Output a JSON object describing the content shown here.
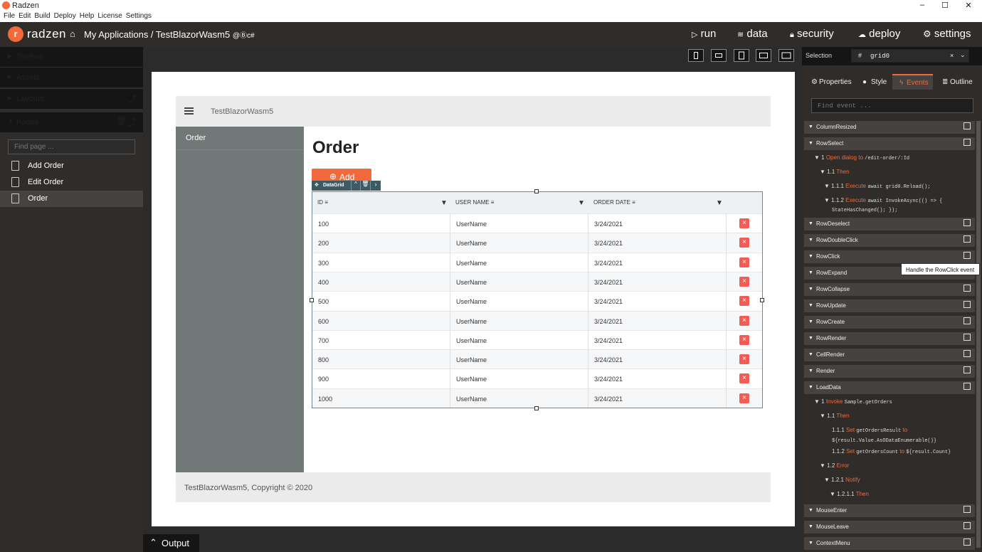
{
  "window": {
    "title": "Radzen",
    "controls": [
      "–",
      "☐",
      "✕"
    ]
  },
  "menubar": [
    "File",
    "Edit",
    "Build",
    "Deploy",
    "Help",
    "License",
    "Settings"
  ],
  "appbar": {
    "brand": "radzen",
    "breadcrumb": "My Applications / TestBlazorWasm5",
    "badges": "@Ⓑc#",
    "nav": [
      {
        "icon": "play-icon",
        "label": "run"
      },
      {
        "icon": "database-icon",
        "label": "data"
      },
      {
        "icon": "lock-icon",
        "label": "security"
      },
      {
        "icon": "cloud-icon",
        "label": "deploy"
      },
      {
        "icon": "gear-icon",
        "label": "settings"
      }
    ]
  },
  "sidebar": {
    "sections": [
      "Toolbox",
      "Assets",
      "Layouts",
      "Pages"
    ],
    "find_placeholder": "Find page ...",
    "pages": [
      "Add Order",
      "Edit Order",
      "Order"
    ],
    "selected_page": "Order"
  },
  "output_tab": "Output",
  "preview": {
    "app_name": "TestBlazorWasm5",
    "side_menu_item": "Order",
    "heading": "Order",
    "add_button": "Add",
    "datagrid_tag": "DataGrid",
    "columns": [
      "ID",
      "USER NAME",
      "ORDER DATE"
    ],
    "rows": [
      [
        "100",
        "UserName",
        "3/24/2021"
      ],
      [
        "200",
        "UserName",
        "3/24/2021"
      ],
      [
        "300",
        "UserName",
        "3/24/2021"
      ],
      [
        "400",
        "UserName",
        "3/24/2021"
      ],
      [
        "500",
        "UserName",
        "3/24/2021"
      ],
      [
        "600",
        "UserName",
        "3/24/2021"
      ],
      [
        "700",
        "UserName",
        "3/24/2021"
      ],
      [
        "800",
        "UserName",
        "3/24/2021"
      ],
      [
        "900",
        "UserName",
        "3/24/2021"
      ],
      [
        "1000",
        "UserName",
        "3/24/2021"
      ]
    ],
    "footer": "TestBlazorWasm5, Copyright © 2020"
  },
  "rightpanel": {
    "selection_label": "Selection",
    "selection_value": "grid0",
    "tabs": [
      "Properties",
      "Style",
      "Events",
      "Outline"
    ],
    "active_tab": "Events",
    "find_placeholder": "Find event ...",
    "tooltip": "Handle the RowClick event",
    "events": {
      "ColumnResized": "ColumnResized",
      "RowSelect": "RowSelect",
      "RowDeselect": "RowDeselect",
      "RowDoubleClick": "RowDoubleClick",
      "RowClick": "RowClick",
      "RowExpand": "RowExpand",
      "RowCollapse": "RowCollapse",
      "RowUpdate": "RowUpdate",
      "RowCreate": "RowCreate",
      "RowRender": "RowRender",
      "CellRender": "CellRender",
      "Render": "Render",
      "LoadData": "LoadData",
      "MouseEnter": "MouseEnter",
      "MouseLeave": "MouseLeave",
      "ContextMenu": "ContextMenu"
    },
    "rowselect": {
      "l1": "1",
      "l1kw": "Open dialog",
      "l1to": "to",
      "l1path": "/edit-order/:Id",
      "l2": "1.1",
      "l2kw": "Then",
      "l3": "1.1.1",
      "l3kw": "Execute",
      "l3code": "await grid0.Reload();",
      "l4": "1.1.2",
      "l4kw": "Execute",
      "l4code": "await InvokeAsync(() => {",
      "l4code2": "StateHasChanged(); });"
    },
    "loaddata": {
      "l1": "1",
      "l1kw": "Invoke",
      "l1code": "Sample.getOrders",
      "l2": "1.1",
      "l2kw": "Then",
      "l3": "1.1.1",
      "l3kw": "Set",
      "l3code": "getOrdersResult",
      "l3to": "to",
      "l3code2": "${result.Value.AsODataEnumerable()}",
      "l4": "1.1.2",
      "l4kw": "Set",
      "l4code": "getOrdersCount",
      "l4to": "to",
      "l4code2": "${result.Count}",
      "l5": "1.2",
      "l5kw": "Error",
      "l6": "1.2.1",
      "l6kw": "Notify",
      "l7": "1.2.1.1",
      "l7kw": "Then"
    }
  }
}
